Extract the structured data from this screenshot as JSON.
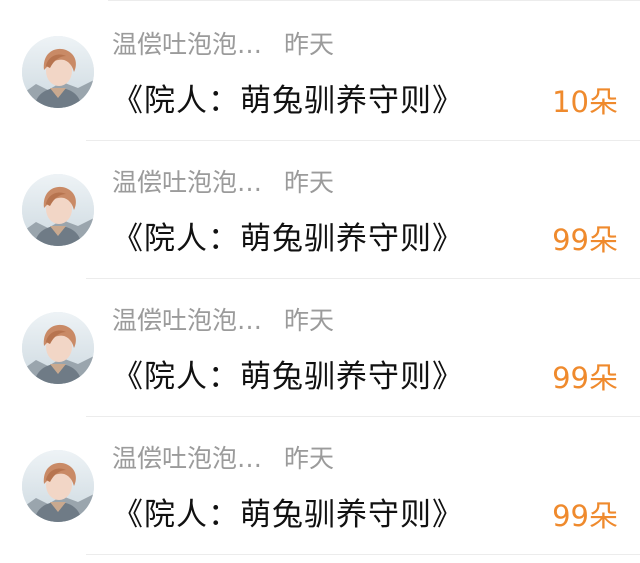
{
  "colors": {
    "accent": "#ef8a2d",
    "meta_text": "#9b9b9b",
    "message_text": "#111111",
    "divider": "#ececec"
  },
  "rows": [
    {
      "avatar_icon": "user-avatar",
      "name": "温偿吐泡泡…",
      "time": "昨天",
      "message": "《院人：萌兔驯养守则》",
      "gift": "10朵"
    },
    {
      "avatar_icon": "user-avatar",
      "name": "温偿吐泡泡…",
      "time": "昨天",
      "message": "《院人：萌兔驯养守则》",
      "gift": "99朵"
    },
    {
      "avatar_icon": "user-avatar",
      "name": "温偿吐泡泡…",
      "time": "昨天",
      "message": "《院人：萌兔驯养守则》",
      "gift": "99朵"
    },
    {
      "avatar_icon": "user-avatar",
      "name": "温偿吐泡泡…",
      "time": "昨天",
      "message": "《院人：萌兔驯养守则》",
      "gift": "99朵"
    }
  ]
}
